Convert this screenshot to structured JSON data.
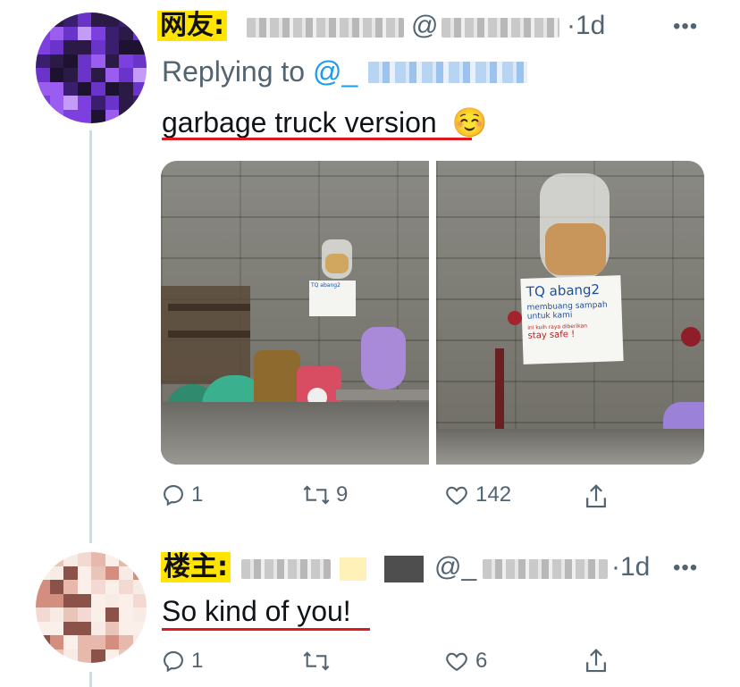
{
  "tweet1": {
    "tag": "网友:",
    "handle_prefix": "@",
    "time": "1d",
    "replying_label": "Replying to",
    "replying_handle": "@_",
    "text": "garbage truck version",
    "emoji": "☺️",
    "media": {
      "note_text_1": "TQ abang2",
      "note_text_2": "membuang sampah",
      "note_text_3": "untuk kami",
      "note_text_4": "ini kuih raya diberikan",
      "note_text_5": "stay safe !"
    },
    "actions": {
      "reply_count": "1",
      "retweet_count": "9",
      "like_count": "142"
    }
  },
  "tweet2": {
    "tag": "楼主:",
    "handle_prefix": "@_",
    "time": "1d",
    "text": "So kind of you!",
    "actions": {
      "reply_count": "1",
      "retweet_count": "",
      "like_count": "6"
    }
  },
  "colors": {
    "accent_blue": "#1d9bf0",
    "secondary_text": "#536471",
    "underline_red": "#e0191e",
    "tag_yellow": "#ffe400"
  },
  "icons": [
    "more-icon",
    "reply-icon",
    "retweet-icon",
    "like-icon",
    "share-icon"
  ]
}
